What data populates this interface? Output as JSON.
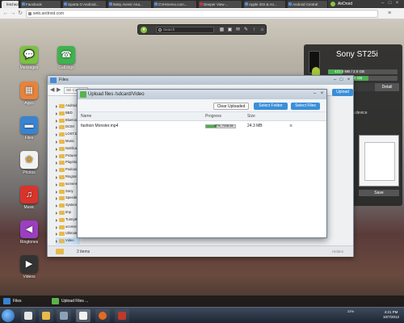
{
  "browser": {
    "tabs": [
      {
        "label": "fetched"
      },
      {
        "label": "Facebook"
      },
      {
        "label": "Sparta O Android..."
      },
      {
        "label": "Baby Avenir Ana..."
      },
      {
        "label": "CVHmemo.com..."
      },
      {
        "label": "Deeper View ..."
      },
      {
        "label": "Apple iOS & An..."
      },
      {
        "label": "Android Central"
      }
    ],
    "airdroid_tab": "AirDroid",
    "url": "web.airdroid.com"
  },
  "airdroid_toolbar": {
    "search_placeholder": "Search"
  },
  "desktop_icons": [
    {
      "label": "Messages",
      "color": "#7cc242",
      "glyph": "💬"
    },
    {
      "label": "Call logs",
      "color": "#3fb34f",
      "glyph": "☎"
    },
    {
      "label": "Apps",
      "color": "#e8833a",
      "glyph": "▦"
    },
    {
      "label": "Files",
      "color": "#3a83d0",
      "glyph": "▬"
    },
    {
      "label": "Photos",
      "color": "#f2f2f2",
      "glyph": "✿"
    },
    {
      "label": "Music",
      "color": "#d9342b",
      "glyph": "♫"
    },
    {
      "label": "Ringtones",
      "color": "#9b3fc1",
      "glyph": "◀"
    },
    {
      "label": "Videos",
      "color": "#333333",
      "glyph": "▶"
    }
  ],
  "device": {
    "name": "Sony ST25i",
    "storage_1": {
      "text": "421.0 MB / 2.0 GB",
      "fill_fraction": 0.21
    },
    "storage_2": {
      "text": "1.17 GB / 2.0 GB",
      "fill_fraction": 0.58
    },
    "detail_label": "Detail",
    "open_on_device": "Open on device",
    "save_label": "Save"
  },
  "files_window": {
    "title": "Files",
    "path": "SD Card",
    "download_label": "Download",
    "upload_label": "Upload",
    "folders": [
      {
        "name": "Android",
        "selected": false
      },
      {
        "name": "BBD",
        "selected": false
      },
      {
        "name": "Bluetooth",
        "selected": false
      },
      {
        "name": "DCIM",
        "selected": false
      },
      {
        "name": "LOST.DIR",
        "selected": false
      },
      {
        "name": "Music",
        "selected": false
      },
      {
        "name": "Notifications",
        "selected": false
      },
      {
        "name": "Pictures",
        "selected": false
      },
      {
        "name": "PlayStation",
        "selected": false
      },
      {
        "name": "Podcasts",
        "selected": false
      },
      {
        "name": "Ringtones",
        "selected": false
      },
      {
        "name": "screenshots",
        "selected": false
      },
      {
        "name": "Sony",
        "selected": false
      },
      {
        "name": "Speedtest",
        "selected": false
      },
      {
        "name": "System",
        "selected": false
      },
      {
        "name": "tmp",
        "selected": false
      },
      {
        "name": "TunnyBrowser",
        "selected": false
      },
      {
        "name": "uconnect",
        "selected": false
      },
      {
        "name": "Ultimate",
        "selected": false
      },
      {
        "name": "Video",
        "selected": true
      },
      {
        "name": "Whatsapp",
        "selected": false
      }
    ],
    "items_count": "2 items",
    "hidden_label": "Hidden"
  },
  "upload_dialog": {
    "title": "Upload files /sdcard/Video",
    "clear_uploaded": "Clear Uploaded",
    "select_folder": "Select Folder",
    "select_files": "Select Files",
    "columns": [
      "Name",
      "Progress",
      "Size"
    ],
    "rows": [
      {
        "name": "fashion Monster.mp4",
        "progress_text": "37%, 7/2/8.94",
        "progress_fraction": 0.37,
        "size": "24.3 MB"
      }
    ]
  },
  "bottom_strip": {
    "files_item": "Files",
    "upload_item": "Upload Files ..."
  },
  "taskbar": {
    "tray_battery": "22%",
    "time": "4:21 PM",
    "date": "10/7/2012"
  }
}
